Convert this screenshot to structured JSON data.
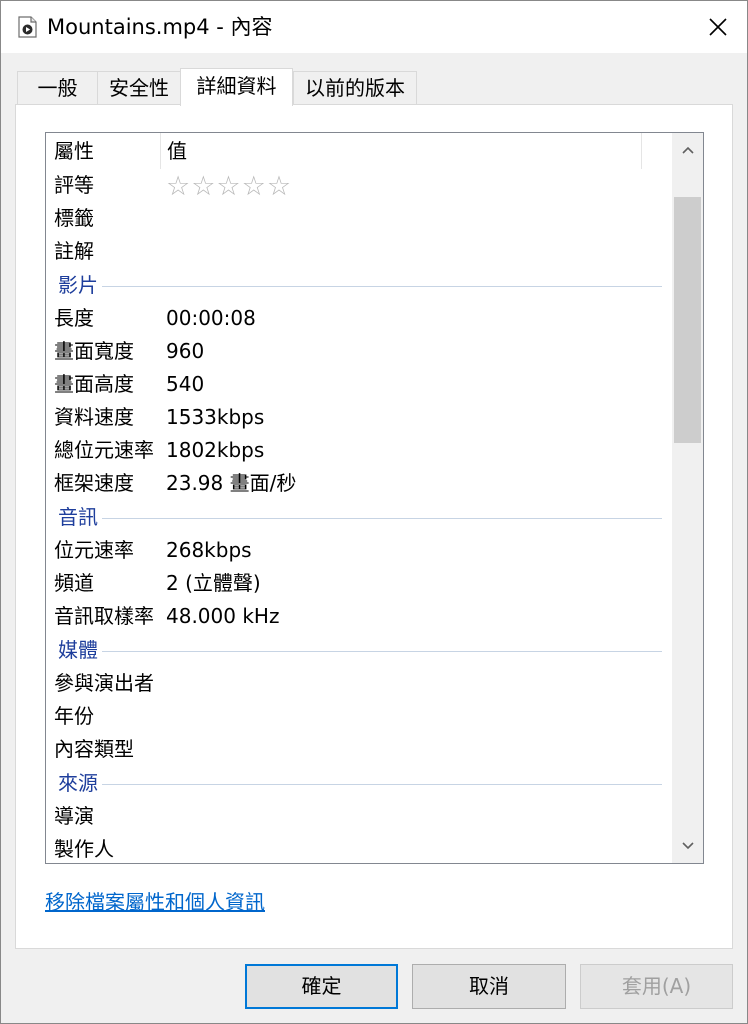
{
  "window": {
    "title": "Mountains.mp4 - 內容",
    "title_icon": "video-file-icon",
    "close_icon": "close-icon"
  },
  "tabs": [
    {
      "label": "一般",
      "active": false
    },
    {
      "label": "安全性",
      "active": false
    },
    {
      "label": "詳細資料",
      "active": true
    },
    {
      "label": "以前的版本",
      "active": false
    }
  ],
  "details": {
    "header": {
      "name": "屬性",
      "value": "值"
    },
    "rating_stars": "☆☆☆☆☆",
    "rows": [
      {
        "kind": "prop",
        "name": "評等",
        "value": ""
      },
      {
        "kind": "prop",
        "name": "標籤",
        "value": ""
      },
      {
        "kind": "prop",
        "name": "註解",
        "value": ""
      },
      {
        "kind": "group",
        "name": "影片"
      },
      {
        "kind": "prop",
        "name": "長度",
        "value": "00:00:08"
      },
      {
        "kind": "prop",
        "name": "畫面寬度",
        "value": "960"
      },
      {
        "kind": "prop",
        "name": "畫面高度",
        "value": "540"
      },
      {
        "kind": "prop",
        "name": "資料速度",
        "value": "1533kbps"
      },
      {
        "kind": "prop",
        "name": "總位元速率",
        "value": "1802kbps"
      },
      {
        "kind": "prop",
        "name": "框架速度",
        "value": "23.98 畫面/秒"
      },
      {
        "kind": "group",
        "name": "音訊"
      },
      {
        "kind": "prop",
        "name": "位元速率",
        "value": "268kbps"
      },
      {
        "kind": "prop",
        "name": "頻道",
        "value": "2 (立體聲)"
      },
      {
        "kind": "prop",
        "name": "音訊取樣率",
        "value": "48.000 kHz"
      },
      {
        "kind": "group",
        "name": "媒體"
      },
      {
        "kind": "prop",
        "name": "參與演出者",
        "value": ""
      },
      {
        "kind": "prop",
        "name": "年份",
        "value": ""
      },
      {
        "kind": "prop",
        "name": "內容類型",
        "value": ""
      },
      {
        "kind": "group",
        "name": "來源"
      },
      {
        "kind": "prop",
        "name": "導演",
        "value": ""
      },
      {
        "kind": "prop",
        "name": "製作人",
        "value": ""
      }
    ]
  },
  "remove_link": "移除檔案屬性和個人資訊",
  "buttons": {
    "ok": "確定",
    "cancel": "取消",
    "apply": "套用(A)"
  },
  "colors": {
    "group_header": "#1e3e9c",
    "link": "#0066cc",
    "default_button_border": "#0078d7"
  }
}
